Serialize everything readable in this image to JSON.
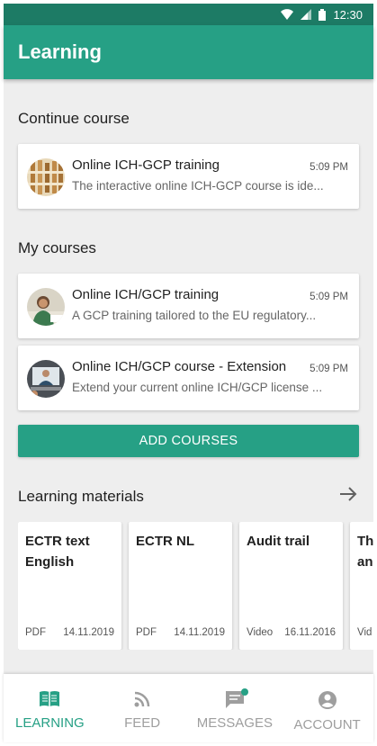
{
  "status_bar": {
    "time": "12:30",
    "icons": [
      "wifi-icon",
      "signal-icon",
      "battery-icon"
    ]
  },
  "app_bar": {
    "title": "Learning"
  },
  "colors": {
    "primary": "#26a085",
    "primary_dark": "#1d7b65",
    "background": "#eeeeee"
  },
  "continue_course": {
    "title": "Continue course",
    "items": [
      {
        "title": "Online ICH-GCP training",
        "subtitle": "The interactive online ICH-GCP course is ide...",
        "time": "5:09 PM"
      }
    ]
  },
  "my_courses": {
    "title": "My courses",
    "items": [
      {
        "title": "Online ICH/GCP training",
        "subtitle": "A GCP training tailored to the EU regulatory...",
        "time": "5:09 PM"
      },
      {
        "title": "Online ICH/GCP course - Extension",
        "subtitle": "Extend your current online ICH/GCP license ...",
        "time": "5:09 PM"
      }
    ],
    "add_button": "ADD COURSES"
  },
  "learning_materials": {
    "title": "Learning materials",
    "items": [
      {
        "title": "ECTR text English",
        "type": "PDF",
        "date": "14.11.2019"
      },
      {
        "title": "ECTR NL",
        "type": "PDF",
        "date": "14.11.2019"
      },
      {
        "title": "Audit trail",
        "type": "Video",
        "date": "16.11.2016"
      },
      {
        "title": "Th an",
        "type": "Vid",
        "date": ""
      }
    ]
  },
  "bottom_nav": {
    "items": [
      {
        "label": "LEARNING",
        "icon": "book-icon",
        "active": true
      },
      {
        "label": "FEED",
        "icon": "rss-icon",
        "active": false
      },
      {
        "label": "MESSAGES",
        "icon": "message-icon",
        "active": false,
        "badge": true
      },
      {
        "label": "ACCOUNT",
        "icon": "account-icon",
        "active": false
      }
    ]
  }
}
